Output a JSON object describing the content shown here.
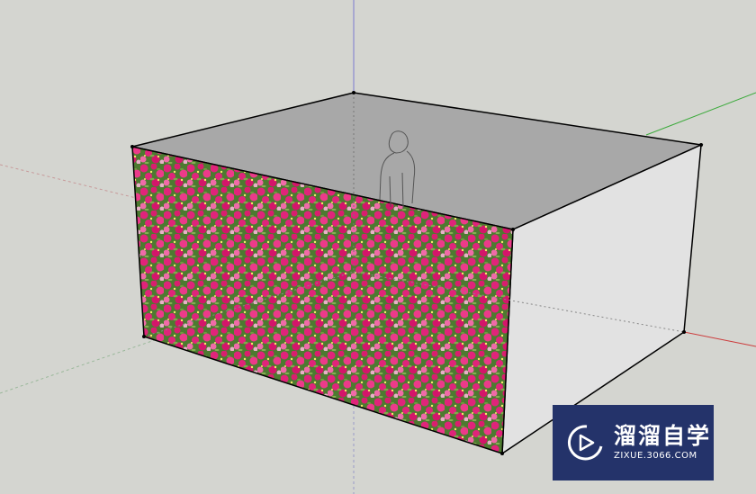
{
  "colors": {
    "background": "#d4d5d0",
    "top_face": "#a8a8a8",
    "right_face": "#e2e2e2",
    "flower_green": "#4d7a30",
    "flower_pink": "#e0247a",
    "watermark_bg": "#24336a"
  },
  "scene": {
    "axes": [
      "blue-z-axis",
      "green-y-axis",
      "red-x-axis"
    ],
    "model": "box-with-flower-texture",
    "figure": "person-scale-figure"
  },
  "watermark": {
    "icon": "play-logo-icon",
    "name": "溜溜自学",
    "url": "ZIXUE.3066.COM"
  }
}
